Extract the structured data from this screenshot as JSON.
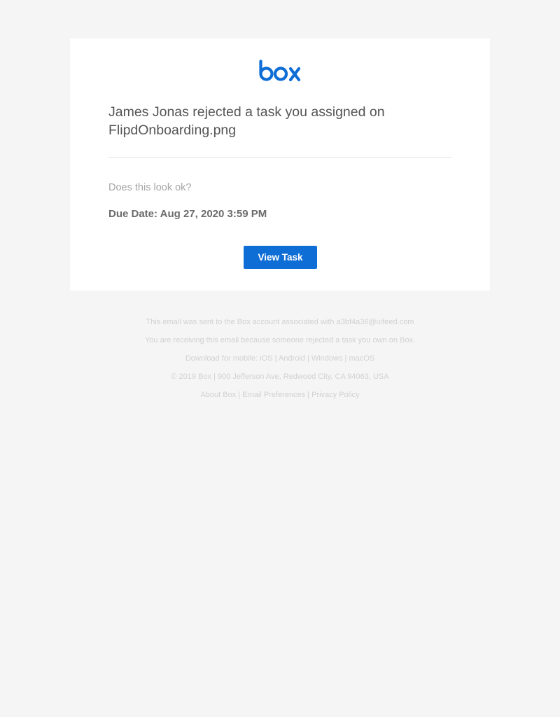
{
  "brand": {
    "logo_text": "box",
    "color": "#0f6ed6"
  },
  "notification": {
    "headline": "James Jonas rejected a task you assigned on FlipdOnboarding.png",
    "question": "Does this look ok?",
    "due_label": "Due Date:",
    "due_value": "Aug 27, 2020 3:59 PM",
    "button_label": "View Task"
  },
  "footer": {
    "sent_to_prefix": "This email was sent to the Box account associated with",
    "sent_to_email": "a3bf4a36@uifeed.com",
    "reason": "You are receiving this email because someone rejected a task you own on Box.",
    "download_prefix": "Download for mobile:",
    "download_links": [
      "iOS",
      "Android",
      "Windows",
      "macOS"
    ],
    "separator": "|",
    "copyright": "© 2019 Box | 900 Jefferson Ave, Redwood City, CA 94063, USA",
    "bottom_links": [
      "About Box",
      "Email Preferences",
      "Privacy Policy"
    ]
  }
}
